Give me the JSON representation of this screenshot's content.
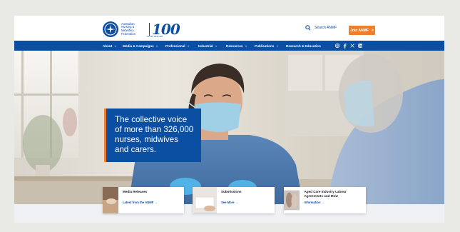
{
  "logo": {
    "org_line1": "Australian",
    "org_line2": "Nursing &",
    "org_line3": "Midwifery",
    "org_line4": "Federation",
    "centenary": "100",
    "centenary_sub": "YEAR SERIES"
  },
  "header": {
    "search_label": "Search ANMF",
    "join_label": "Join ANMF",
    "join_chevron": ">"
  },
  "nav": {
    "items": [
      {
        "label": "About",
        "dropdown": true
      },
      {
        "label": "Media & Campaigns",
        "dropdown": true
      },
      {
        "label": "Professional",
        "dropdown": true
      },
      {
        "label": "Industrial",
        "dropdown": true
      },
      {
        "label": "Resources",
        "dropdown": true
      },
      {
        "label": "Publications",
        "dropdown": true
      },
      {
        "label": "Research & Education",
        "dropdown": false
      }
    ],
    "chevron": "∨",
    "social": [
      "instagram-icon",
      "facebook-icon",
      "x-icon",
      "linkedin-icon"
    ]
  },
  "hero": {
    "tagline": "The collective voice of more than 326,000 nurses, midwives and carers."
  },
  "cards": [
    {
      "title": "Media Releases",
      "link": "Latest from the ANMF →"
    },
    {
      "title": "Submissions",
      "link": "See More →"
    },
    {
      "title": "Aged Care Industry Labour Agreements and MoU",
      "link": "Information →"
    }
  ],
  "colors": {
    "brand_blue": "#0b4fa3",
    "accent_orange": "#f07e2a"
  }
}
